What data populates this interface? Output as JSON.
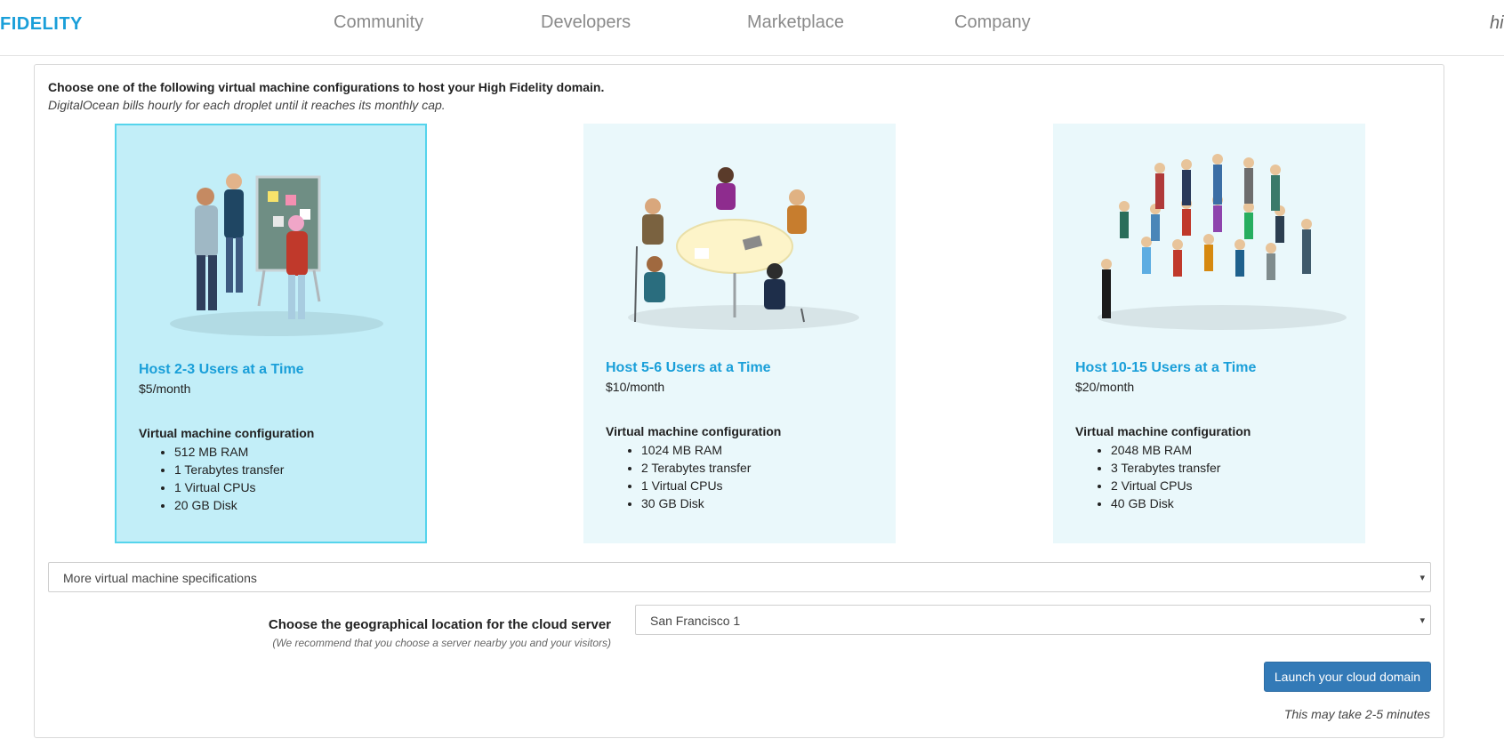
{
  "header": {
    "brand": "FIDELITY",
    "nav": [
      "Community",
      "Developers",
      "Marketplace",
      "Company"
    ],
    "user_partial": "hi"
  },
  "intro": {
    "heading": "Choose one of the following virtual machine configurations to host your High Fidelity domain.",
    "subheading": "DigitalOcean bills hourly for each droplet until it reaches its monthly cap."
  },
  "plans": [
    {
      "title": "Host 2-3 Users at a Time",
      "price": "$5/month",
      "config_heading": "Virtual machine configuration",
      "specs": [
        "512 MB RAM",
        "1 Terabytes transfer",
        "1 Virtual CPUs",
        "20 GB Disk"
      ],
      "selected": true
    },
    {
      "title": "Host 5-6 Users at a Time",
      "price": "$10/month",
      "config_heading": "Virtual machine configuration",
      "specs": [
        "1024 MB RAM",
        "2 Terabytes transfer",
        "1 Virtual CPUs",
        "30 GB Disk"
      ],
      "selected": false
    },
    {
      "title": "Host 10-15 Users at a Time",
      "price": "$20/month",
      "config_heading": "Virtual machine configuration",
      "specs": [
        "2048 MB RAM",
        "3 Terabytes transfer",
        "2 Virtual CPUs",
        "40 GB Disk"
      ],
      "selected": false
    }
  ],
  "specs_dropdown": {
    "value": "More virtual machine specifications",
    "caret": "▾"
  },
  "location": {
    "label": "Choose the geographical location for the cloud server",
    "hint": "(We recommend that you choose a server nearby you and your visitors)",
    "value": "San Francisco 1",
    "caret": "▾"
  },
  "launch": {
    "label": "Launch your cloud domain",
    "note": "This may take 2-5 minutes"
  },
  "colors": {
    "brand": "#1a9fd9",
    "card_bg": "#eaf8fb",
    "card_selected_bg": "#c2eef8",
    "card_selected_border": "#55d4ec",
    "button": "#337ab7"
  }
}
